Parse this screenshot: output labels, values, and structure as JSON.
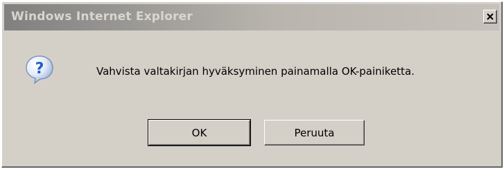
{
  "window": {
    "title": "Windows Internet Explorer",
    "close_label": "close"
  },
  "dialog": {
    "icon": "question-icon",
    "message": "Vahvista valtakirjan hyväksyminen painamalla OK-painiketta."
  },
  "buttons": {
    "ok_label": "OK",
    "cancel_label": "Peruuta"
  },
  "colors": {
    "face": "#d4d0c8",
    "title_gradient_start": "#808080",
    "title_text": "#d9d6cf",
    "icon_blue": "#1f5fbf"
  }
}
